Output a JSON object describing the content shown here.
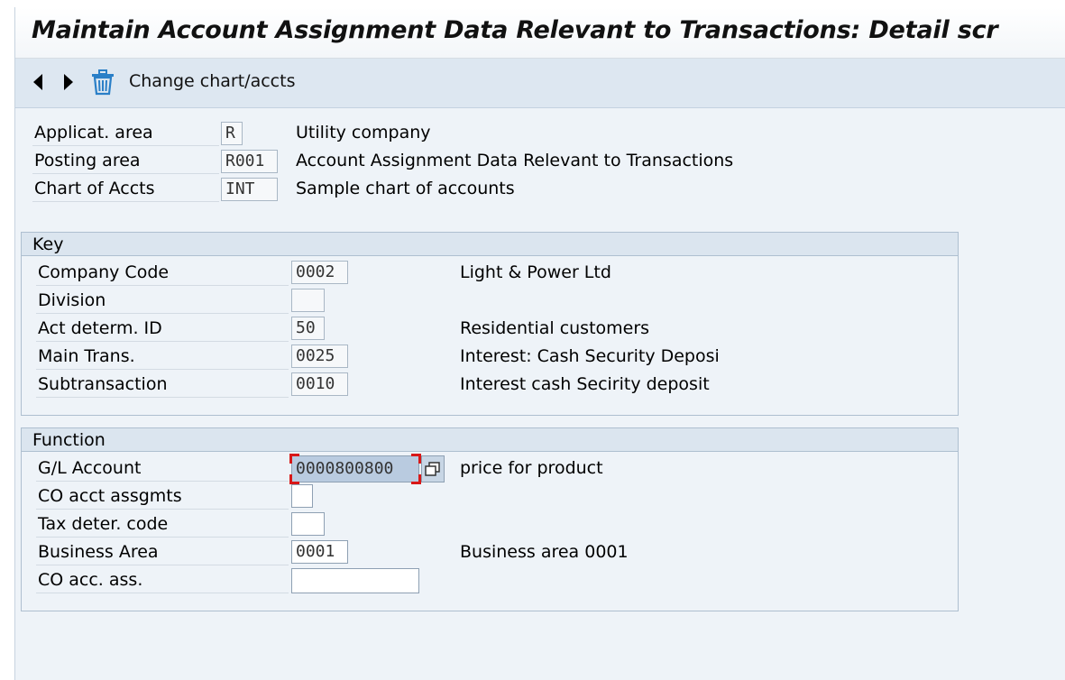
{
  "window": {
    "title": "Maintain Account Assignment Data Relevant to Transactions: Detail scr"
  },
  "toolbar": {
    "prev_icon": "triangle-left-icon",
    "next_icon": "triangle-right-icon",
    "delete_icon": "trash-icon",
    "change_label": "Change chart/accts"
  },
  "header": {
    "rows": [
      {
        "label": "Applicat. area",
        "value": "R",
        "description": "Utility company"
      },
      {
        "label": "Posting area",
        "value": "R001",
        "description": "Account Assignment Data Relevant to Transactions"
      },
      {
        "label": "Chart of Accts",
        "value": "INT",
        "description": "Sample chart of accounts"
      }
    ]
  },
  "key_group": {
    "title": "Key",
    "rows": [
      {
        "label": "Company Code",
        "value": "0002",
        "description": "Light & Power Ltd"
      },
      {
        "label": "Division",
        "value": "",
        "description": ""
      },
      {
        "label": "Act determ. ID",
        "value": "50",
        "description": "Residential customers"
      },
      {
        "label": "Main Trans.",
        "value": "0025",
        "description": "Interest: Cash Security Deposi"
      },
      {
        "label": "Subtransaction",
        "value": "0010",
        "description": "Interest cash Secirity deposit"
      }
    ]
  },
  "function_group": {
    "title": "Function",
    "rows": [
      {
        "label": "G/L Account",
        "value": "0000800800",
        "description": "price for product"
      },
      {
        "label": "CO acct assgmts",
        "value": "",
        "description": ""
      },
      {
        "label": "Tax deter. code",
        "value": "",
        "description": ""
      },
      {
        "label": "Business Area",
        "value": "0001",
        "description": "Business area 0001"
      },
      {
        "label": "CO acc. ass.",
        "value": "",
        "description": ""
      }
    ],
    "gl_value_help_icon": "value-help-icon"
  },
  "colors": {
    "background": "#eef3f8",
    "toolbar": "#dde7f1",
    "focus_marker": "#d81818",
    "selected_field": "#b9cbe0"
  }
}
